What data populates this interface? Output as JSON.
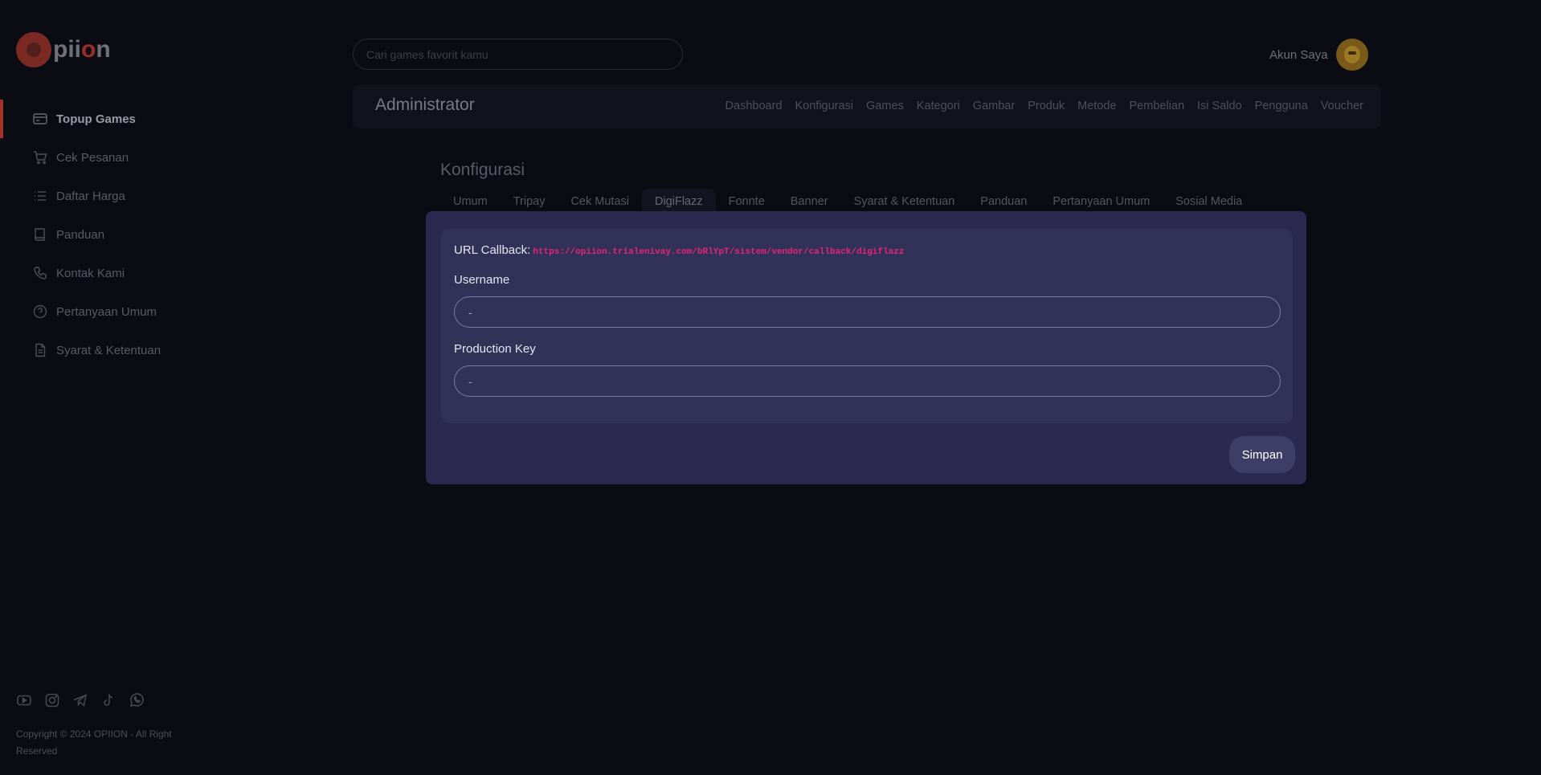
{
  "brand": {
    "name_prefix": "pii",
    "name_o": "o",
    "name_suffix": "n"
  },
  "sidebar": {
    "items": [
      {
        "label": "Topup Games",
        "icon": "card-icon",
        "active": true
      },
      {
        "label": "Cek Pesanan",
        "icon": "cart-icon",
        "active": false
      },
      {
        "label": "Daftar Harga",
        "icon": "list-icon",
        "active": false
      },
      {
        "label": "Panduan",
        "icon": "book-icon",
        "active": false
      },
      {
        "label": "Kontak Kami",
        "icon": "phone-icon",
        "active": false
      },
      {
        "label": "Pertanyaan Umum",
        "icon": "question-icon",
        "active": false
      },
      {
        "label": "Syarat & Ketentuan",
        "icon": "document-icon",
        "active": false
      }
    ],
    "socials": [
      "youtube-icon",
      "instagram-icon",
      "telegram-icon",
      "tiktok-icon",
      "whatsapp-icon"
    ],
    "copyright": "Copyright © 2024 OPIION - All Right Reserved"
  },
  "header": {
    "search_placeholder": "Cari games favorit kamu",
    "account_label": "Akun Saya"
  },
  "admin": {
    "title": "Administrator",
    "menu": [
      "Dashboard",
      "Konfigurasi",
      "Games",
      "Kategori",
      "Gambar",
      "Produk",
      "Metode",
      "Pembelian",
      "Isi Saldo",
      "Pengguna",
      "Voucher"
    ]
  },
  "config": {
    "heading": "Konfigurasi",
    "tabs": [
      "Umum",
      "Tripay",
      "Cek Mutasi",
      "DigiFlazz",
      "Fonnte",
      "Banner",
      "Syarat & Ketentuan",
      "Panduan",
      "Pertanyaan Umum",
      "Sosial Media"
    ],
    "active_tab": "DigiFlazz"
  },
  "form": {
    "callback_label": "URL Callback",
    "callback_colon": ":",
    "callback_url": "https://opiion.trialenivay.com/bRlYpT/sistem/vendor/callback/digiflazz",
    "username_label": "Username",
    "username_value": "-",
    "production_key_label": "Production Key",
    "production_key_value": "-",
    "save_label": "Simpan"
  },
  "colors": {
    "background": "#0b0b14",
    "accent": "#a13426",
    "modal": "#2b2950",
    "url": "#e0267a"
  }
}
